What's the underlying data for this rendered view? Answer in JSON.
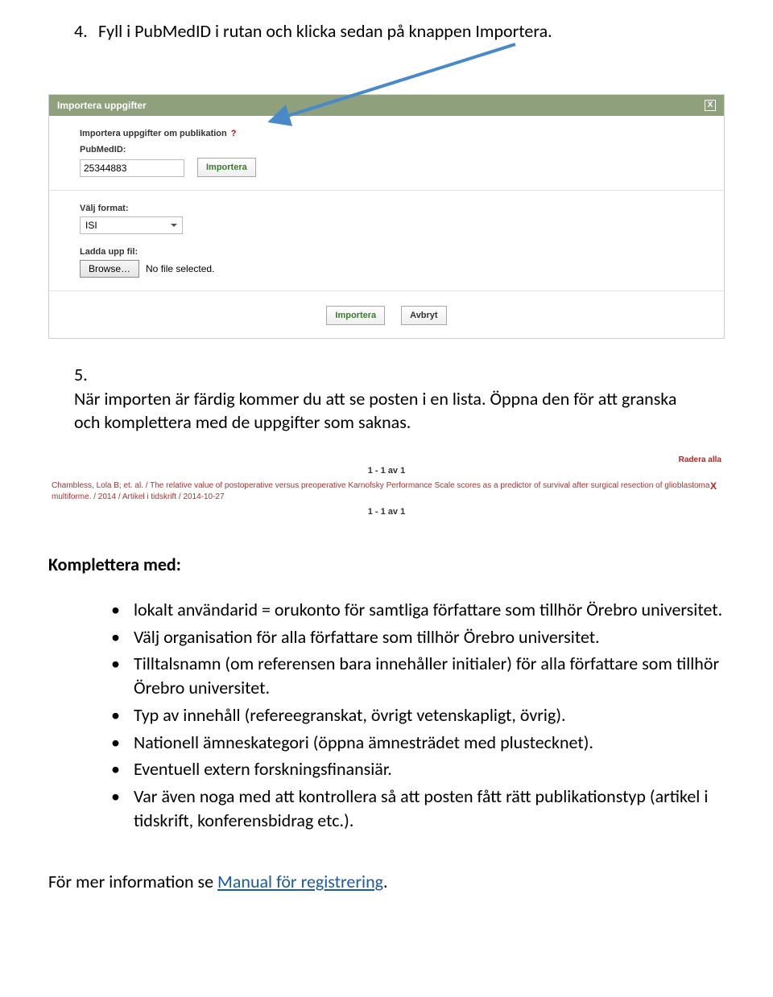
{
  "step4": {
    "num": "4.",
    "text": "Fyll i PubMedID i rutan och klicka sedan på knappen Importera."
  },
  "panel": {
    "title": "Importera uppgifter",
    "close": "X",
    "subheading": "Importera uppgifter om publikation",
    "pubmedid_label": "PubMedID:",
    "pubmedid_value": "25344883",
    "importera_small": "Importera",
    "format_label": "Välj format:",
    "format_value": "ISI",
    "upload_label": "Ladda upp fil:",
    "browse_label": "Browse…",
    "no_file": "No file selected.",
    "importera_big": "Importera",
    "avbryt": "Avbryt"
  },
  "step5": {
    "num": "5.",
    "text": "När importen är färdig kommer du att se posten i en lista. Öppna den för att granska och komplettera med de uppgifter som saknas."
  },
  "results": {
    "pager": "1 - 1 av 1",
    "radera_alla": "Radera alla",
    "citation": "Chambless, Lola B; et. al. / The relative value of postoperative versus preoperative Karnofsky Performance Scale scores as a predictor of survival after surgical resection of glioblastoma multiforme. / 2014 / Artikel i tidskrift / 2014-10-27",
    "row_x": "X",
    "pager2": "1 - 1 av 1"
  },
  "komplettera_heading": "Komplettera med:",
  "komplettera_items": [
    "lokalt användarid = orukonto för samtliga författare som tillhör Örebro universitet.",
    "Välj organisation för alla författare som tillhör Örebro universitet.",
    "Tilltalsnamn (om referensen bara innehåller initialer) för alla författare som tillhör Örebro universitet.",
    "Typ av innehåll (refereegranskat, övrigt vetenskapligt, övrig).",
    "Nationell ämneskategori (öppna ämnesträdet med plustecknet).",
    "Eventuell extern forskningsfinansiär.",
    "Var även noga med att kontrollera så att posten fått rätt publikationstyp (artikel i tidskrift, konferensbidrag etc.)."
  ],
  "footer": {
    "prefix": "För mer information se ",
    "link": "Manual för registrering",
    "suffix": "."
  }
}
